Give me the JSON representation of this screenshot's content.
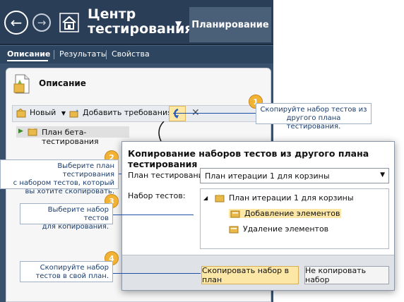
{
  "header": {
    "back_glyph": "←",
    "forward_glyph": "→",
    "title": "Центр\nтестирования",
    "title_line1": "Центр",
    "title_line2": "тестирования",
    "active_tab": "Планирование"
  },
  "subnav": {
    "items": [
      "Описание",
      "Результаты",
      "Свойства"
    ]
  },
  "panel": {
    "title": "Описание",
    "toolbar": {
      "new_label": "Новый",
      "add_requirements_label": "Добавить требования"
    },
    "tree_item": "План бета-тестирования"
  },
  "dialog": {
    "title": "Копирование наборов тестов из другого плана тестирования",
    "plan_label": "План тестирования:",
    "plan_value": "План итерации 1 для корзины",
    "suite_label": "Набор тестов:",
    "tree": {
      "root": "План итерации 1 для корзины",
      "children": [
        "Добавление элементов",
        "Удаление элементов"
      ]
    },
    "copy_button": "Скопировать набор в план",
    "nocopy_button": "Не копировать набор"
  },
  "callouts": [
    {
      "number": "1",
      "line1": "Скопируйте набор тестов из",
      "line2": "другого плана тестирования.",
      "line3": ""
    },
    {
      "number": "2",
      "line1": "Выберите план тестирования",
      "line2": "с набором тестов, который",
      "line3": "вы хотите скопировать."
    },
    {
      "number": "3",
      "line1": "Выберите набор тестов",
      "line2": "для копирования.",
      "line3": ""
    },
    {
      "number": "4",
      "line1": "Скопируйте набор",
      "line2": "тестов в свой план.",
      "line3": ""
    }
  ],
  "colors": {
    "header_bg": "#2a3f57",
    "accent_button": "#fde7a6",
    "callout_number": "#f2b233",
    "callout_line": "#1e4fa6"
  },
  "icons": [
    "back-icon",
    "forward-icon",
    "home-icon",
    "description-icon",
    "new-icon",
    "add-requirements-icon",
    "copy-suite-icon",
    "cancel-icon",
    "test-suite-icon"
  ]
}
